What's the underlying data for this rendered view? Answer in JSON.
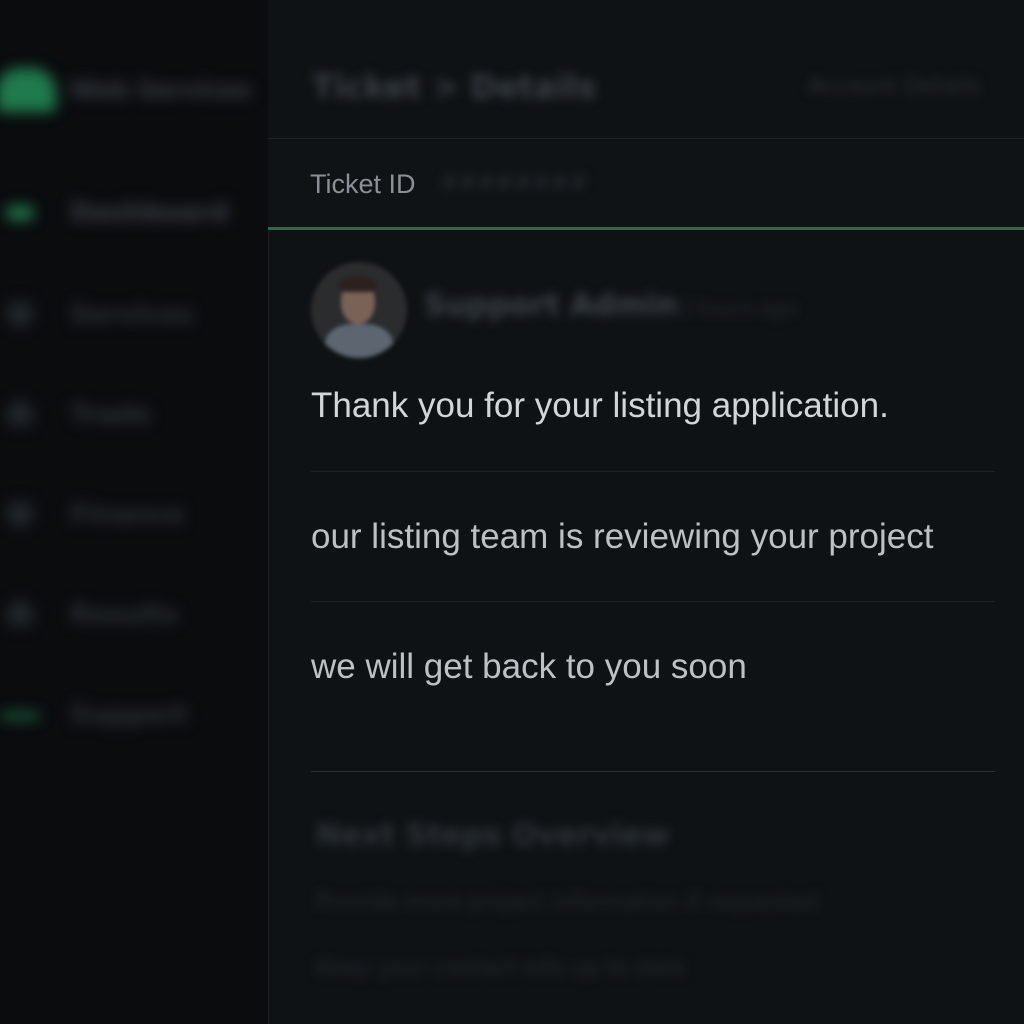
{
  "sidebar": {
    "brand": "Web Services",
    "items": [
      {
        "label": "Dashboard"
      },
      {
        "label": "Services"
      },
      {
        "label": "Trade"
      },
      {
        "label": "Finance"
      },
      {
        "label": "Results"
      },
      {
        "label": "Support"
      }
    ]
  },
  "header": {
    "title": "Ticket > Details",
    "right_text": "Account Details"
  },
  "ticket": {
    "label": "Ticket ID",
    "value": "########"
  },
  "message": {
    "sender_name": "Support Admin",
    "sender_time": "2 hours ago",
    "lines": [
      "Thank you for your listing application.",
      "our listing team is reviewing your project",
      "we will get back to you soon"
    ]
  },
  "footer": {
    "title": "Next Steps Overview",
    "lines": [
      "Provide more project information if requested",
      "Keep your contact info up to date"
    ]
  },
  "colors": {
    "accent": "#2b6b45",
    "background": "#0f1215",
    "sidebar": "#0a0c0e",
    "text": "#bcc1c6"
  }
}
